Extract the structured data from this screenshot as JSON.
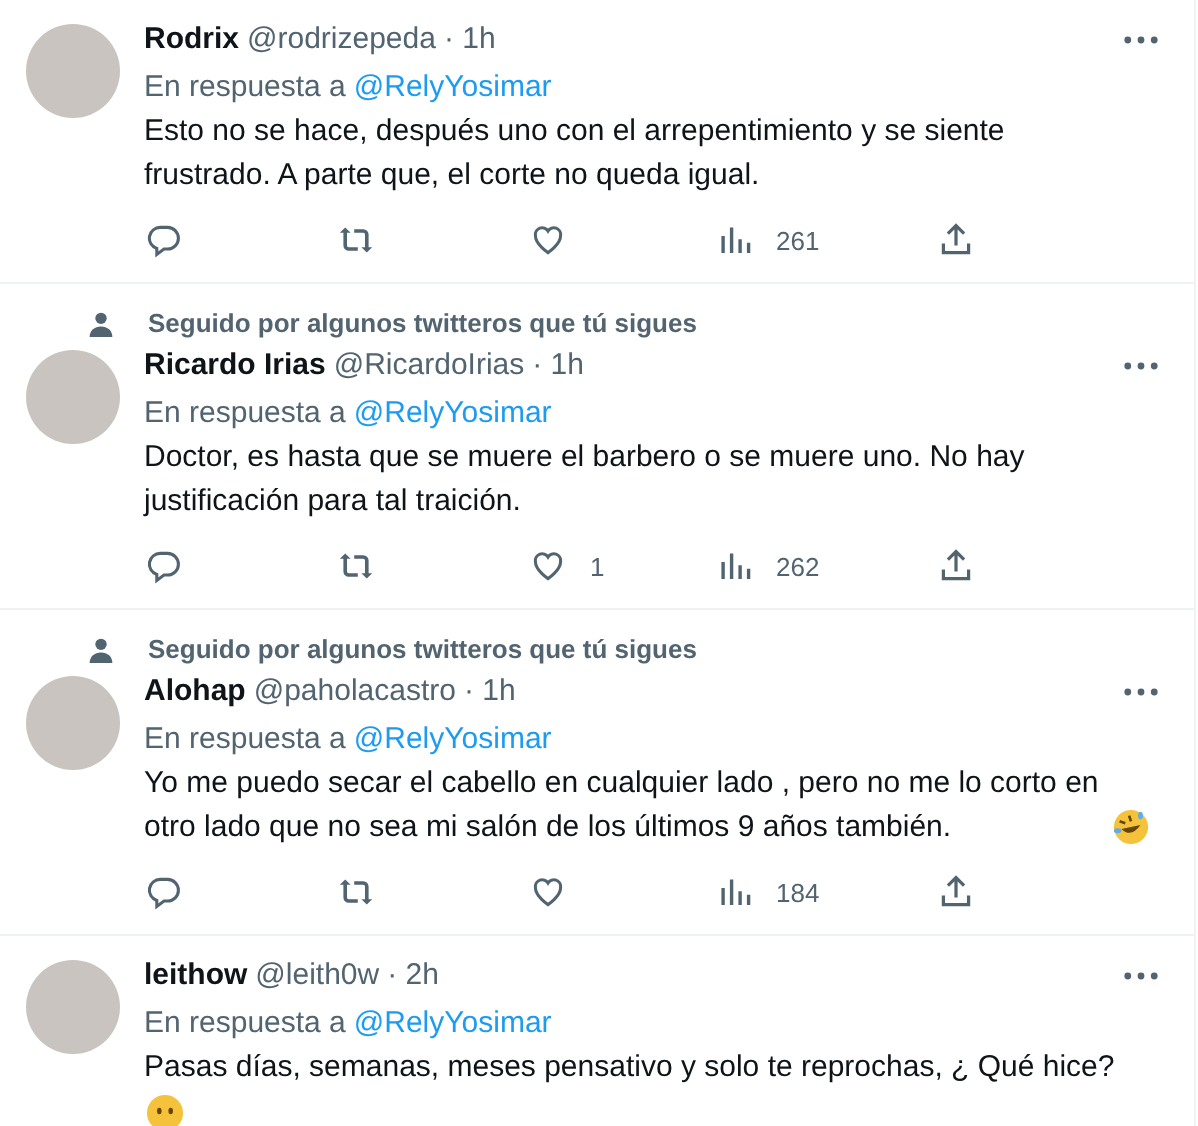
{
  "tweets": [
    {
      "kind": "plain",
      "name": "Rodrix",
      "handle": "@rodrizepeda",
      "time": "· 1h",
      "reply_label": "En respuesta a",
      "reply_to": "@RelyYosimar",
      "text": "Esto no se hace, después uno con el arrepentimiento y se siente frustrado. A parte que, el corte no queda igual.",
      "views": "261"
    },
    {
      "kind": "plain",
      "followed_note": "Seguido por algunos twitteros que tú sigues",
      "name": "Ricardo Irias",
      "handle": "@RicardoIrias",
      "time": "· 1h",
      "reply_label": "En respuesta a",
      "reply_to": "@RelyYosimar",
      "text": "Doctor, es hasta que se muere el barbero o se muere uno. No hay justificación para tal traición.",
      "likes": "1",
      "views": "262"
    },
    {
      "kind": "laughing",
      "followed_note": "Seguido por algunos twitteros que tú sigues",
      "name": "Alohap",
      "handle": "@paholacastro",
      "time": "· 1h",
      "reply_label": "En respuesta a",
      "reply_to": "@RelyYosimar",
      "text": "Yo me puedo secar el cabello en cualquier lado , pero no me lo corto en otro lado que no sea mi salón de los últimos 9 años también.",
      "views": "184"
    },
    {
      "kind": "speechless",
      "name": "leithow",
      "handle": "@leith0w",
      "time": "· 2h",
      "reply_label": "En respuesta a",
      "reply_to": "@RelyYosimar",
      "text": "Pasas días, semanas, meses pensativo y solo te reprochas, ¿ Qué hice?"
    }
  ]
}
